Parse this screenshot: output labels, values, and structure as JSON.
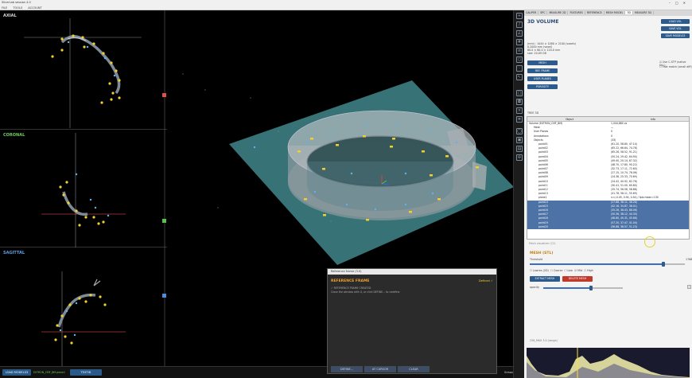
{
  "app_title": "SlicerLab session 4.0",
  "menu": [
    "FILE",
    "TOOLS",
    "ACCOUNT"
  ],
  "slices": [
    {
      "label": "AXIAL",
      "color": "#d9d9d9"
    },
    {
      "label": "CORONAL",
      "color": "#6fd05a"
    },
    {
      "label": "SAGITTAL",
      "color": "#5aa0e8"
    }
  ],
  "bottom": {
    "load_label": "LOAD MODELS3",
    "file_name": "EXTRON_CMF_BM.plane1",
    "textid_label": "TEXTID",
    "status": "Scissors"
  },
  "tabs": [
    "CALIPER",
    "SPC",
    "MEASURE 2D",
    "FEATURES",
    "REFERENCE",
    "MESH MODEL",
    "3D",
    "MEASURE 3D"
  ],
  "volume": {
    "title": "3D VOLUME",
    "info": [
      "(mm) : 1044 × 1080 × 2100 (voxels)",
      "0.2000 mm (voxel)",
      "80.0 × 80.0 × 120.0 mm",
      "size: 20.09 GB"
    ],
    "btn_load": "LOAD VOL",
    "btn_save": "SAVE VOL",
    "btn_models": "SAVE MODELS3",
    "btn_mesh": "MESH",
    "btn_ref": "REF. FRAME",
    "btn_planes": "USER PLANES",
    "btn_porosity": "POROSITY",
    "chk1": "Use C-STP (native DLL)",
    "chk2": "Fast match (small diff)"
  },
  "tree": {
    "section": "TREE 3D",
    "col_object": "Object",
    "col_info": "Info",
    "rows": [
      {
        "name": "Volume (EXTRON_CMF_BM)",
        "info": "1,044,880 vx",
        "indent": 0,
        "sel": false
      },
      {
        "name": "Mesh",
        "info": "—",
        "indent": 1,
        "sel": false
      },
      {
        "name": "User Planes",
        "info": "0",
        "indent": 1,
        "sel": false
      },
      {
        "name": "Annotations",
        "info": "0",
        "indent": 1,
        "sel": false
      },
      {
        "name": "Objects",
        "info": "(33)",
        "indent": 1,
        "sel": false
      },
      {
        "name": "point01",
        "info": "(61.20, 58.80, 47.14)",
        "indent": 2,
        "sel": false
      },
      {
        "name": "point02",
        "info": "(65.22, 66.64, 74.78)",
        "indent": 2,
        "sel": false
      },
      {
        "name": "point03",
        "info": "(65.26, 58.52, 91.21)",
        "indent": 2,
        "sel": false
      },
      {
        "name": "point04",
        "info": "(50.24, 29.42, 64.90)",
        "indent": 2,
        "sel": false
      },
      {
        "name": "point05",
        "info": "(49.40, 20.14, 87.32)",
        "indent": 2,
        "sel": false
      },
      {
        "name": "point06",
        "info": "(48.70, 17.80, 90.22)",
        "indent": 2,
        "sel": false
      },
      {
        "name": "point07",
        "info": "(32.73, 17.11, 72.60)",
        "indent": 2,
        "sel": false
      },
      {
        "name": "point08",
        "info": "(27.15, 10.74, 78.06)",
        "indent": 2,
        "sel": false
      },
      {
        "name": "point09",
        "info": "(24.38, 25.33, 70.69)",
        "indent": 2,
        "sel": false
      },
      {
        "name": "point10",
        "info": "(24.42, 40.92, 62.76)",
        "indent": 2,
        "sel": false
      },
      {
        "name": "point11",
        "info": "(30.41, 51.00, 60.80)",
        "indent": 2,
        "sel": false
      },
      {
        "name": "point12",
        "info": "(35.74, 56.58, 58.88)",
        "indent": 2,
        "sel": false
      },
      {
        "name": "point13",
        "info": "(41.78, 58.11, 55.69)",
        "indent": 2,
        "sel": false
      },
      {
        "name": "plane1",
        "info": "n=(-0.05, 0.94, 0.34) / fplo mean=130",
        "indent": 2,
        "sel": false
      },
      {
        "name": "point14",
        "info": "(27.88, 38.11, 48.28)",
        "indent": 2,
        "sel": true
      },
      {
        "name": "point15",
        "info": "(42.16, 34.87, 38.41)",
        "indent": 2,
        "sel": true
      },
      {
        "name": "point16",
        "info": "(35.26, 38.43, 88.06)",
        "indent": 2,
        "sel": true
      },
      {
        "name": "point17",
        "info": "(50.36, 38.12, 44.30)",
        "indent": 2,
        "sel": true
      },
      {
        "name": "point18",
        "info": "(48.80, 40.31, 45.86)",
        "indent": 2,
        "sel": true
      },
      {
        "name": "point19",
        "info": "(57.20, 37.47, 41.04)",
        "indent": 2,
        "sel": true
      },
      {
        "name": "point20",
        "info": "(56.88, 38.57, 51.23)",
        "indent": 2,
        "sel": true
      }
    ],
    "footer": "Mesh visualizer (C2)"
  },
  "mesh": {
    "title": "MESH (STL)",
    "threshold_label": "Threshold",
    "threshold_value": "1766",
    "threshold_frac": 0.86,
    "options": [
      "Lowres (2D)",
      "Coarse",
      "Low",
      "Mid",
      "High"
    ],
    "btn_extract": "EXTRACT MESH",
    "btn_delete": "DELETE MESH",
    "opacity_label": "opacity",
    "opacity_frac": 0.6,
    "hist_label": "256_MAX 3.0 (range)"
  },
  "dialog": {
    "title": "Reference frame (3.0)",
    "heading": "REFERENCE FRAME",
    "status": "Defined ✓",
    "line1": "✓ REFERENCE FRAME CREATED",
    "line2": "Close the window with X, or click DEFINE... to redefine",
    "btn_define": "DEFINE...",
    "btn_cursor": "AT CURSOR",
    "btn_clear": "CLEAR"
  }
}
